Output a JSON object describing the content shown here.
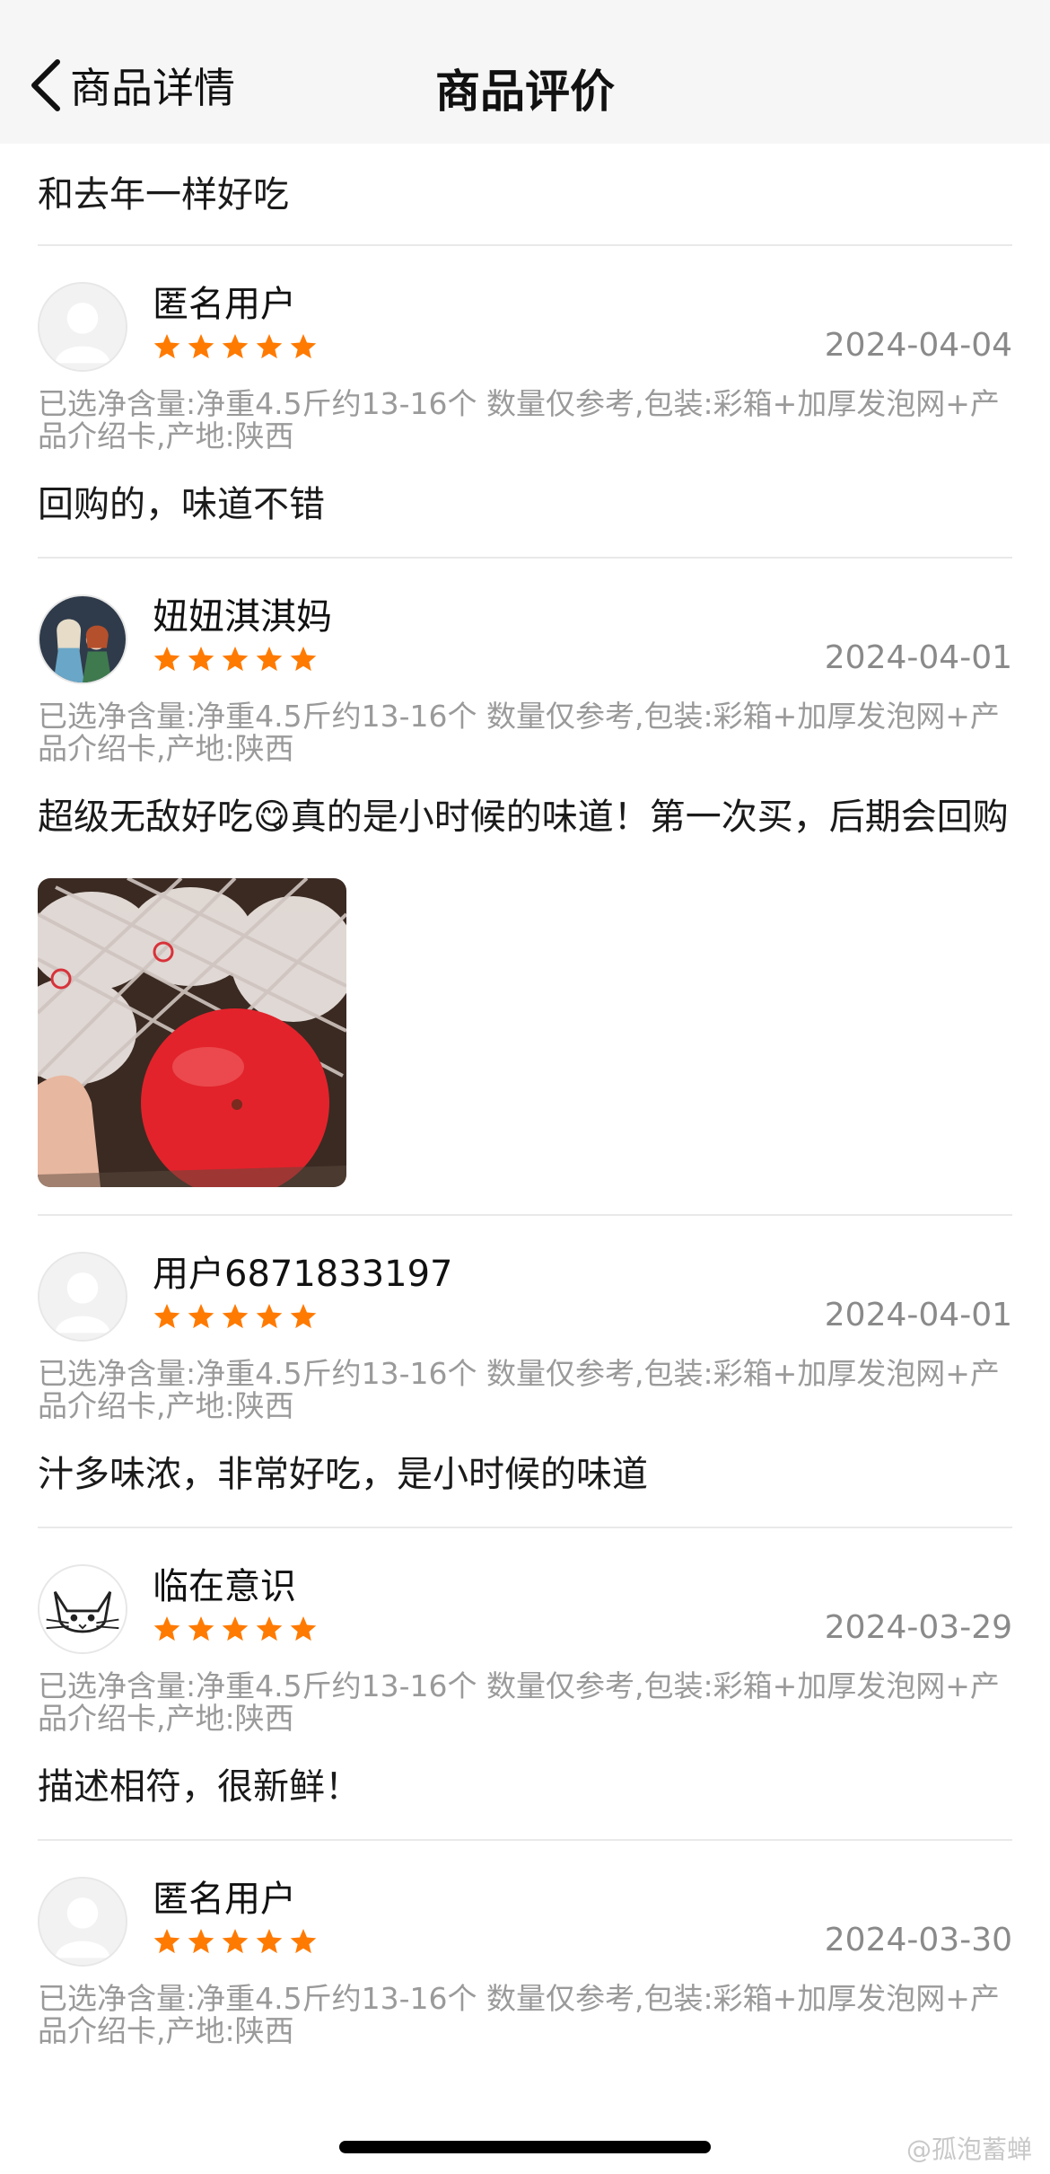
{
  "header": {
    "back_label": "商品详情",
    "title": "商品评价"
  },
  "top_comment": "和去年一样好吃",
  "colors": {
    "star": "#ff7a00",
    "date": "#8a8a8a",
    "spec": "#9a9a9a"
  },
  "reviews": [
    {
      "user": "匿名用户",
      "rating": 5,
      "date": "2024-04-04",
      "spec": "已选净含量:净重4.5斤约13-16个 数量仅参考,包装:彩箱+加厚发泡网+产品介绍卡,产地:陕西",
      "text": "回购的，味道不错",
      "avatar": "default-avatar-icon"
    },
    {
      "user": "妞妞淇淇妈",
      "rating": 5,
      "date": "2024-04-01",
      "spec": "已选净含量:净重4.5斤约13-16个 数量仅参考,包装:彩箱+加厚发泡网+产品介绍卡,产地:陕西",
      "text": "超级无敌好吃😋真的是小时候的味道！第一次买，后期会回购",
      "avatar": "doll-avatar",
      "has_photo": true
    },
    {
      "user": "用户6871833197",
      "rating": 5,
      "date": "2024-04-01",
      "spec": "已选净含量:净重4.5斤约13-16个 数量仅参考,包装:彩箱+加厚发泡网+产品介绍卡,产地:陕西",
      "text": "汁多味浓，非常好吃，是小时候的味道",
      "avatar": "default-avatar-icon"
    },
    {
      "user": "临在意识",
      "rating": 5,
      "date": "2024-03-29",
      "spec": "已选净含量:净重4.5斤约13-16个 数量仅参考,包装:彩箱+加厚发泡网+产品介绍卡,产地:陕西",
      "text": "描述相符，很新鲜！",
      "avatar": "cat-sketch-avatar"
    },
    {
      "user": "匿名用户",
      "rating": 5,
      "date": "2024-03-30",
      "spec": "已选净含量:净重4.5斤约13-16个 数量仅参考,包装:彩箱+加厚发泡网+产品介绍卡,产地:陕西",
      "avatar": "default-avatar-icon"
    }
  ],
  "watermark": "@孤泡蓄蝉"
}
